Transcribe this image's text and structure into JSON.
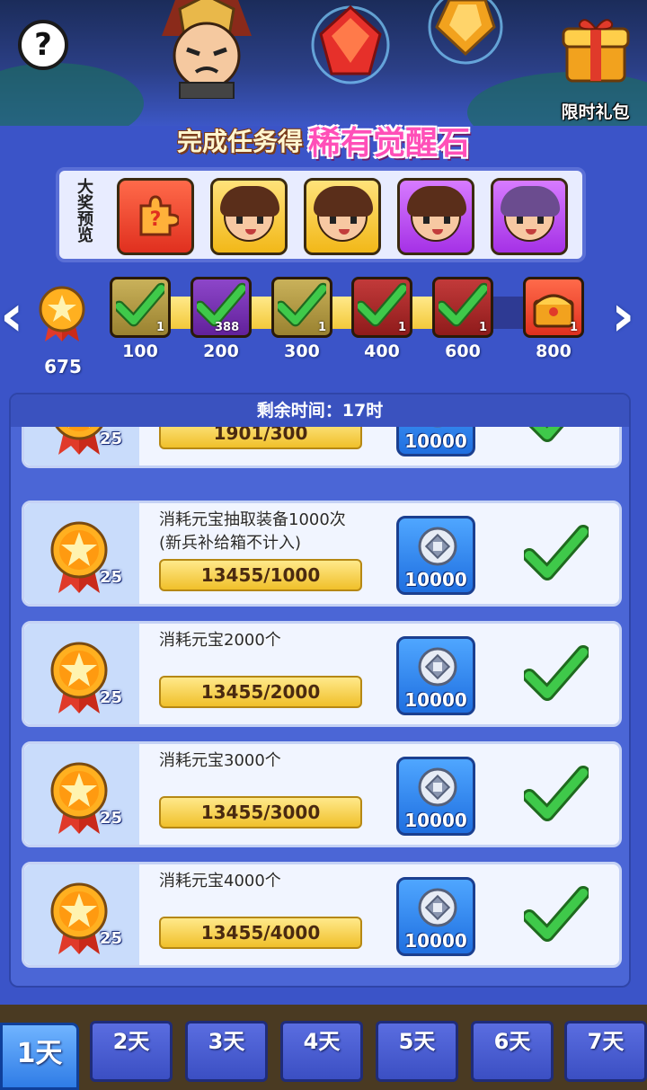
{
  "header": {
    "help_icon": "question-icon",
    "gift_label": "限时礼包"
  },
  "title": {
    "part1": "完成任务得",
    "part2": "稀有觉醒石"
  },
  "preview": {
    "label": "大奖预览",
    "items": [
      {
        "kind": "red",
        "icon": "puzzle-icon"
      },
      {
        "kind": "gold",
        "icon": "hero-portrait-icon"
      },
      {
        "kind": "gold",
        "icon": "hero-portrait-icon"
      },
      {
        "kind": "purple",
        "icon": "hero-portrait-icon"
      },
      {
        "kind": "purple",
        "icon": "hero-portrait-icon"
      }
    ]
  },
  "progress": {
    "score": "675",
    "milestones": [
      {
        "value": "100",
        "count": "1",
        "claimed": true
      },
      {
        "value": "200",
        "count": "388",
        "claimed": true
      },
      {
        "value": "300",
        "count": "1",
        "claimed": true
      },
      {
        "value": "400",
        "count": "1",
        "claimed": true
      },
      {
        "value": "600",
        "count": "1",
        "claimed": true
      },
      {
        "value": "800",
        "count": "1",
        "claimed": false
      }
    ],
    "fill_fraction": 0.83
  },
  "tasks": {
    "timer": "剩余时间：17时",
    "items": [
      {
        "desc_line1": "",
        "desc_line2": "",
        "progress": "1901/300",
        "points": "25",
        "reward": "10000",
        "done": true
      },
      {
        "desc_line1": "消耗元宝抽取装备1000次",
        "desc_line2": "(新兵补给箱不计入)",
        "progress": "13455/1000",
        "points": "25",
        "reward": "10000",
        "done": true
      },
      {
        "desc_line1": "消耗元宝2000个",
        "desc_line2": "",
        "progress": "13455/2000",
        "points": "25",
        "reward": "10000",
        "done": true
      },
      {
        "desc_line1": "消耗元宝3000个",
        "desc_line2": "",
        "progress": "13455/3000",
        "points": "25",
        "reward": "10000",
        "done": true
      },
      {
        "desc_line1": "消耗元宝4000个",
        "desc_line2": "",
        "progress": "13455/4000",
        "points": "25",
        "reward": "10000",
        "done": true
      }
    ]
  },
  "tabs": [
    "1天",
    "2天",
    "3天",
    "4天",
    "5天",
    "6天",
    "7天"
  ],
  "colors": {
    "accent": "#3b54c8",
    "check": "#3fc94a",
    "title_pink": "#ff4fb8"
  }
}
